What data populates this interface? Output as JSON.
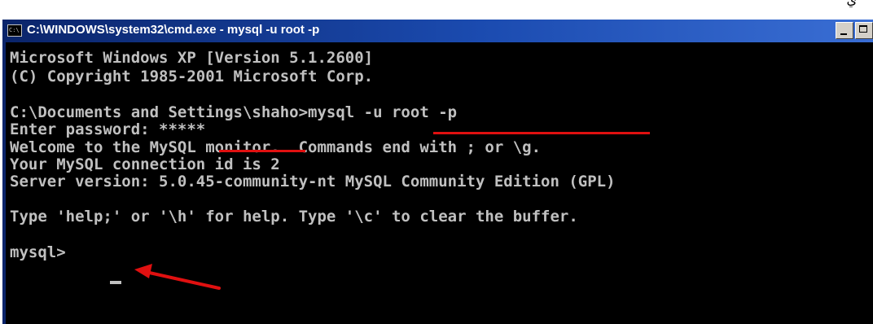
{
  "window": {
    "title": "C:\\WINDOWS\\system32\\cmd.exe - mysql -u root -p",
    "icon_text": "C:\\",
    "icon": "console-icon"
  },
  "corner_text": "ي",
  "console": {
    "lines": [
      "Microsoft Windows XP [Version 5.1.2600]",
      "(C) Copyright 1985-2001 Microsoft Corp.",
      "C:\\Documents and Settings\\shaho>mysql -u root -p",
      "Enter password: *****",
      "Welcome to the MySQL monitor.  Commands end with ; or \\g.",
      "Your MySQL connection id is 2",
      "Server version: 5.0.45-community-nt MySQL Community Edition (GPL)",
      "Type 'help;' or '\\h' for help. Type '\\c' to clear the buffer.",
      "mysql> "
    ]
  },
  "colors": {
    "console_bg": "#000000",
    "console_text": "#c0c0c0",
    "annotation": "#e01010",
    "titlebar": "#0a246a"
  }
}
